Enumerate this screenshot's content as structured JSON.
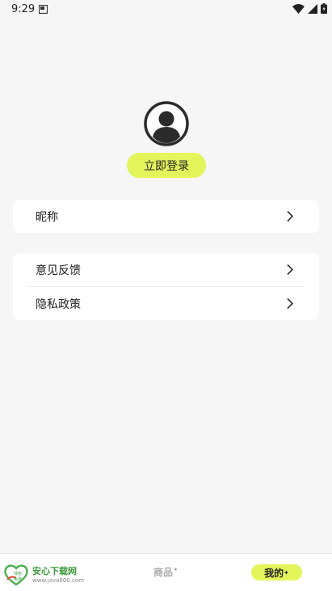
{
  "status_bar": {
    "time": "9:29",
    "icons": [
      "sim-card-icon",
      "wifi-icon",
      "signal-icon",
      "battery-icon"
    ]
  },
  "profile": {
    "avatar_icon": "user-avatar-icon",
    "login_label": "立即登录"
  },
  "menu": {
    "nickname_label": "昵称",
    "items": [
      {
        "label": "意见反馈"
      },
      {
        "label": "隐私政策"
      }
    ],
    "chevron_icon": "chevron-right-icon"
  },
  "bottom_nav": {
    "tabs": [
      {
        "label": "商品",
        "active": false
      },
      {
        "label": "我的",
        "active": true
      }
    ],
    "sparkle": "✦"
  },
  "watermark": {
    "title": "安心下载网",
    "url": "www.java800.com",
    "badge_top": "绿色",
    "badge_bottom": "免费"
  },
  "colors": {
    "accent": "#e3f55a",
    "background": "#f6f6f6",
    "card": "#ffffff",
    "text": "#222222"
  }
}
